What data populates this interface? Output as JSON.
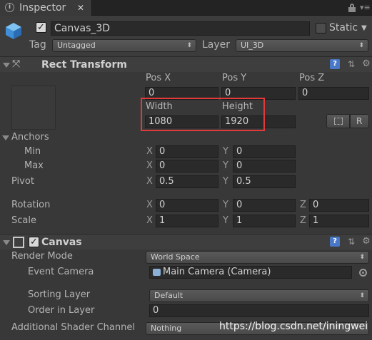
{
  "tab": {
    "title": "Inspector",
    "close": "✕"
  },
  "object": {
    "name": "Canvas_3D",
    "static_label": "Static",
    "tag_label": "Tag",
    "tag_value": "Untagged",
    "layer_label": "Layer",
    "layer_value": "UI_3D"
  },
  "rect_transform": {
    "title": "Rect Transform",
    "pos_x_label": "Pos X",
    "pos_y_label": "Pos Y",
    "pos_z_label": "Pos Z",
    "pos_x": "0",
    "pos_y": "0",
    "pos_z": "0",
    "width_label": "Width",
    "height_label": "Height",
    "width": "1080",
    "height": "1920",
    "raw_label": "R",
    "anchors_label": "Anchors",
    "min_label": "Min",
    "max_label": "Max",
    "min_x": "0",
    "min_y": "0",
    "max_x": "0",
    "max_y": "0",
    "pivot_label": "Pivot",
    "pivot_x": "0.5",
    "pivot_y": "0.5",
    "rotation_label": "Rotation",
    "rot_x": "0",
    "rot_y": "0",
    "rot_z": "0",
    "scale_label": "Scale",
    "scale_x": "1",
    "scale_y": "1",
    "scale_z": "1",
    "x": "X",
    "y": "Y",
    "z": "Z"
  },
  "canvas": {
    "title": "Canvas",
    "render_mode_label": "Render Mode",
    "render_mode_value": "World Space",
    "event_camera_label": "Event Camera",
    "event_camera_value": "Main Camera (Camera)",
    "sorting_layer_label": "Sorting Layer",
    "sorting_layer_value": "Default",
    "order_label": "Order in Layer",
    "order_value": "0",
    "shader_label": "Additional Shader Channel",
    "shader_value": "Nothing"
  },
  "watermark": "https://blog.csdn.net/iningwei",
  "colors": {
    "highlight": "#e03a3a",
    "help_blue": "#4a78c8"
  }
}
